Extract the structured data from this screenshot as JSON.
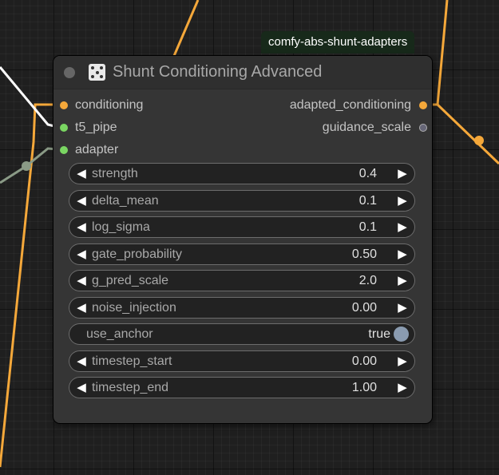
{
  "colors": {
    "wire_orange": "#f5a83a",
    "wire_white": "#ffffff",
    "wire_sage": "#8a9a86",
    "slot_conditioning": "#f5a83a",
    "slot_green": "#7ad662",
    "slot_guidance": "#666677",
    "toggle_knob": "#8a9bb0"
  },
  "badge": {
    "label": "comfy-abs-shunt-adapters"
  },
  "node": {
    "title": "Shunt Conditioning Advanced",
    "title_icon": "expand-arrows-icon",
    "inputs": [
      {
        "label": "conditioning",
        "color": "#f5a83a"
      },
      {
        "label": "t5_pipe",
        "color": "#7ad662"
      },
      {
        "label": "adapter",
        "color": "#7ad662"
      }
    ],
    "outputs": [
      {
        "label": "adapted_conditioning",
        "color": "#f5a83a"
      },
      {
        "label": "guidance_scale",
        "color": "#666677"
      }
    ],
    "widgets": [
      {
        "name": "strength",
        "value": "0.4"
      },
      {
        "name": "delta_mean",
        "value": "0.1"
      },
      {
        "name": "log_sigma",
        "value": "0.1"
      },
      {
        "name": "gate_probability",
        "value": "0.50"
      },
      {
        "name": "g_pred_scale",
        "value": "2.0"
      },
      {
        "name": "noise_injection",
        "value": "0.00"
      },
      {
        "name": "use_anchor",
        "value": "true",
        "type": "toggle"
      },
      {
        "name": "timestep_start",
        "value": "0.00"
      },
      {
        "name": "timestep_end",
        "value": "1.00"
      }
    ],
    "arrow_left": "◀",
    "arrow_right": "▶"
  }
}
